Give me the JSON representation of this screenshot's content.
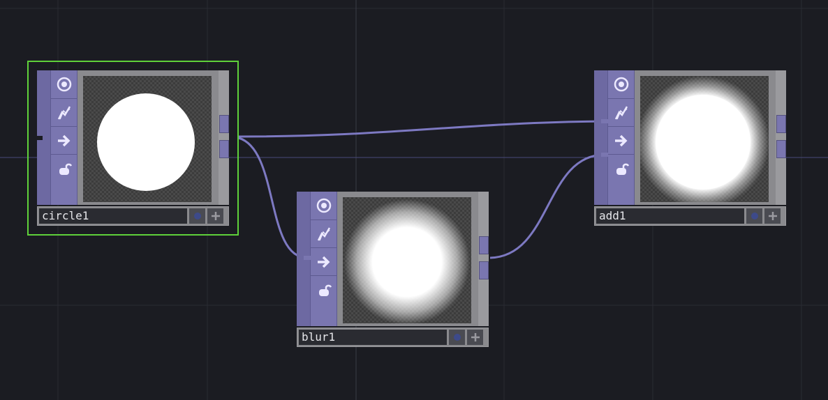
{
  "network": {
    "nodes": [
      {
        "id": "circle1",
        "name": "circle1",
        "selected": true,
        "preview": "circle-sharp"
      },
      {
        "id": "blur1",
        "name": "blur1",
        "selected": false,
        "preview": "circle-blurred"
      },
      {
        "id": "add1",
        "name": "add1",
        "selected": false,
        "preview": "circle-glow"
      }
    ],
    "connections": [
      {
        "from": "circle1",
        "to": "add1",
        "input": 1
      },
      {
        "from": "circle1",
        "to": "blur1",
        "input": 1
      },
      {
        "from": "blur1",
        "to": "add1",
        "input": 2
      }
    ],
    "strip_icons": [
      "viewer-toggle-icon",
      "cook-flag-icon",
      "display-arrow-icon",
      "lock-icon"
    ],
    "colors": {
      "background": "#1b1c22",
      "node_strip": "#7a76b0",
      "wire": "#7d79c2",
      "selection": "#5fd13a"
    }
  }
}
